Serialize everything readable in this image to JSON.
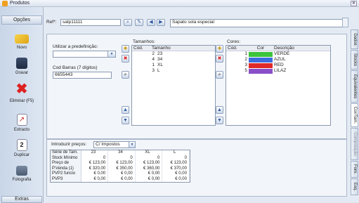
{
  "window": {
    "title": "Produtos"
  },
  "sidebar": {
    "header": "Opções",
    "footer": "Extras",
    "items": [
      {
        "label": "Novo",
        "icon": "new-folder-icon"
      },
      {
        "label": "Gravar",
        "icon": "save-icon"
      },
      {
        "label": "Eliminar (F5)",
        "icon": "delete-icon"
      },
      {
        "label": "Extracto",
        "icon": "extract-icon"
      },
      {
        "label": "Duplicar",
        "icon": "duplicate-icon"
      },
      {
        "label": "Fotografia",
        "icon": "photo-icon"
      }
    ]
  },
  "top": {
    "ref_label": "Ref*:",
    "ref_value": "satp11111",
    "desc_value": "Sapato sola especial"
  },
  "form": {
    "predef_label": "Utilizar a predefinição:",
    "predef_value": "",
    "barcode_label": "Cod Barras (7 dígitos)",
    "barcode_value": "6655443"
  },
  "sizes": {
    "title": "Tamanhos:",
    "headers": [
      "Cód.",
      "Tamanho"
    ],
    "rows": [
      [
        "2",
        "23"
      ],
      [
        "4",
        "34"
      ],
      [
        "1",
        "XL"
      ],
      [
        "3",
        "L"
      ]
    ]
  },
  "colors": {
    "title": "Cores:",
    "headers": [
      "Cód.",
      "Cor",
      "Descrição"
    ],
    "rows": [
      {
        "code": "1",
        "color": "#3cc43c",
        "desc": "VERDE"
      },
      {
        "code": "2",
        "color": "#3a6ee0",
        "desc": "AZUL"
      },
      {
        "code": "3",
        "color": "#e02a2a",
        "desc": "RED"
      },
      {
        "code": "5",
        "color": "#8a4fc8",
        "desc": "LILAZ"
      }
    ]
  },
  "prices": {
    "label": "Introduzir preços:",
    "mode": "C/ Impostos",
    "rows": [
      [
        "Série de Tam.",
        "23",
        "34",
        "XL",
        "L"
      ],
      [
        "Stock Mínimo",
        "0",
        "0",
        "0",
        "0"
      ],
      [
        "Preço de Custo",
        "€ 123,00",
        "€ 123,00",
        "€ 123,00",
        "€ 123,00"
      ],
      [
        "P.Venda (1)",
        "€ 320,00",
        "€ 350,00",
        "€ 360,00",
        "€ 370,00"
      ],
      [
        "PVP2 funcio",
        "€ 0,00",
        "€ 0,00",
        "€ 0,00",
        "€ 0,00"
      ],
      [
        "PVP3",
        "€ 0,00",
        "€ 0,00",
        "€ 0,00",
        "€ 0,00"
      ]
    ]
  },
  "tabs": [
    "Dados",
    "Stocks",
    "Equivalentes",
    "Cor/Tam.",
    "Composição",
    "Forn.",
    "Esq."
  ]
}
